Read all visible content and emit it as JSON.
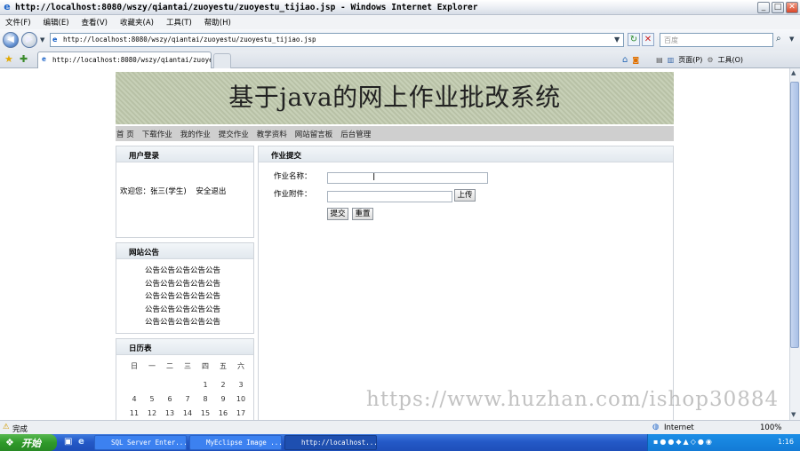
{
  "window": {
    "title": "http://localhost:8080/wszy/qiantai/zuoyestu/zuoyestu_tijiao.jsp - Windows Internet Explorer",
    "min": "_",
    "max": "□",
    "close": "✕"
  },
  "menu": [
    "文件(F)",
    "编辑(E)",
    "查看(V)",
    "收藏夹(A)",
    "工具(T)",
    "帮助(H)"
  ],
  "address": {
    "url": "http://localhost:8080/wszy/qiantai/zuoyestu/zuoyestu_tijiao.jsp",
    "search_placeholder": "百度"
  },
  "tab": {
    "title": "http://localhost:8080/wszy/qiantai/zuoyes..."
  },
  "toolbar_right": {
    "page": "页面(P)",
    "tools": "工具(O)"
  },
  "page": {
    "banner": "基于java的网上作业批改系统",
    "nav": [
      "首 页",
      "下载作业",
      "我的作业",
      "提交作业",
      "教学资料",
      "网站留言板",
      "后台管理"
    ],
    "login": {
      "title": "用户登录",
      "welcome": "欢迎您：张三(学生)",
      "logout": "安全退出"
    },
    "notice": {
      "title": "网站公告",
      "lines": [
        "公告公告公告公告公告",
        "公告公告公告公告公告",
        "公告公告公告公告公告",
        "公告公告公告公告公告",
        "公告公告公告公告公告"
      ]
    },
    "calendar": {
      "title": "日历表",
      "weekdays": [
        "日",
        "一",
        "二",
        "三",
        "四",
        "五",
        "六"
      ],
      "rows": [
        [
          "",
          "",
          "",
          "",
          "1",
          "2",
          "3"
        ],
        [
          "4",
          "5",
          "6",
          "7",
          "8",
          "9",
          "10"
        ],
        [
          "11",
          "12",
          "13",
          "14",
          "15",
          "16",
          "17"
        ]
      ]
    },
    "form": {
      "title": "作业提交",
      "name_label": "作业名称：",
      "name_value": "",
      "attach_label": "作业附件：",
      "attach_value": "",
      "upload": "上传",
      "submit": "提交",
      "reset": "重置"
    }
  },
  "watermark": "https://www.huzhan.com/ishop30884",
  "status": {
    "text": "完成",
    "zone": "Internet",
    "zoom": "100%"
  },
  "taskbar": {
    "start": "开始",
    "tasks": [
      "SQL Server Enter...",
      "MyEclipse Image ...",
      "http://localhost..."
    ],
    "time": "1:16"
  }
}
